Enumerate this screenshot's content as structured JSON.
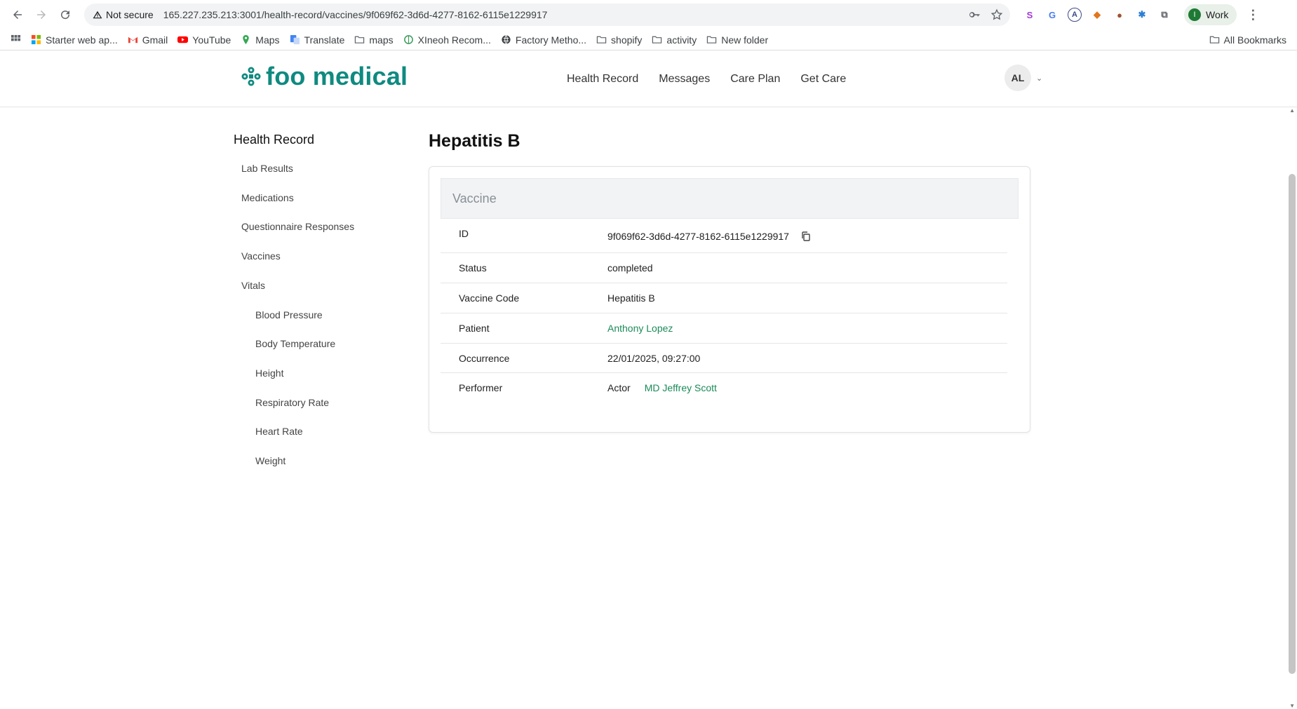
{
  "browser": {
    "security_label": "Not secure",
    "url": "165.227.235.213:3001/health-record/vaccines/9f069f62-3d6d-4277-8162-6115e1229917",
    "profile_initial": "I",
    "profile_name": "Work"
  },
  "bookmarks": {
    "items": [
      {
        "label": "Starter web ap...",
        "icon": "microsoft-icon"
      },
      {
        "label": "Gmail",
        "icon": "gmail-icon"
      },
      {
        "label": "YouTube",
        "icon": "youtube-icon"
      },
      {
        "label": "Maps",
        "icon": "maps-icon"
      },
      {
        "label": "Translate",
        "icon": "translate-icon"
      },
      {
        "label": "maps",
        "icon": "folder-icon"
      },
      {
        "label": "XIneoh Recom...",
        "icon": "globe-icon"
      },
      {
        "label": "Factory Metho...",
        "icon": "globe-icon"
      },
      {
        "label": "shopify",
        "icon": "folder-icon"
      },
      {
        "label": "activity",
        "icon": "folder-icon"
      },
      {
        "label": "New folder",
        "icon": "folder-icon"
      }
    ],
    "all_bookmarks": "All Bookmarks"
  },
  "app": {
    "brand": "foo medical",
    "nav": [
      "Health Record",
      "Messages",
      "Care Plan",
      "Get Care"
    ],
    "avatar_initials": "AL"
  },
  "sidebar": {
    "title": "Health Record",
    "items": [
      "Lab Results",
      "Medications",
      "Questionnaire Responses",
      "Vaccines",
      "Vitals"
    ],
    "vitals_items": [
      "Blood Pressure",
      "Body Temperature",
      "Height",
      "Respiratory Rate",
      "Heart Rate",
      "Weight"
    ]
  },
  "main": {
    "title": "Hepatitis B",
    "card_title": "Vaccine",
    "rows": {
      "id": {
        "label": "ID",
        "value": "9f069f62-3d6d-4277-8162-6115e1229917"
      },
      "status": {
        "label": "Status",
        "value": "completed"
      },
      "vaccine_code": {
        "label": "Vaccine Code",
        "value": "Hepatitis B"
      },
      "patient": {
        "label": "Patient",
        "value": "Anthony Lopez"
      },
      "occurrence": {
        "label": "Occurrence",
        "value": "22/01/2025, 09:27:00"
      },
      "performer": {
        "label": "Performer",
        "role": "Actor",
        "value": "MD Jeffrey Scott"
      }
    }
  },
  "colors": {
    "brand": "#0f8a80",
    "link": "#1b8a5a"
  }
}
